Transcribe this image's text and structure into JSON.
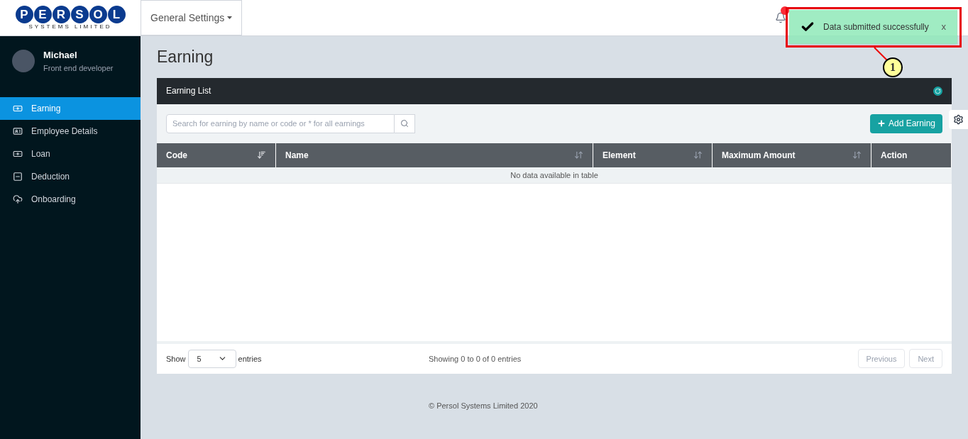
{
  "logo": {
    "letters": [
      "P",
      "E",
      "R",
      "S",
      "O",
      "L"
    ],
    "tagline": "SYSTEMS LIMITED"
  },
  "header": {
    "menu": "General Settings",
    "notification_badge": true
  },
  "toast": {
    "message": "Data submitted successfully",
    "close": "x"
  },
  "annotation": {
    "label": "1"
  },
  "profile": {
    "name": "Michael",
    "role": "Front end developer"
  },
  "nav": [
    {
      "label": "Earning",
      "selected": true
    },
    {
      "label": "Employee Details",
      "selected": false
    },
    {
      "label": "Loan",
      "selected": false
    },
    {
      "label": "Deduction",
      "selected": false
    },
    {
      "label": "Onboarding",
      "selected": false
    }
  ],
  "page_title": "Earning",
  "panel": {
    "title": "Earning List",
    "search": {
      "placeholder": "Search for earning by name or code or * for all earnings"
    },
    "add_button": "Add Earning",
    "table": {
      "columns": [
        {
          "label": "Code",
          "kind": "sorted"
        },
        {
          "label": "Name",
          "kind": "sortable"
        },
        {
          "label": "Element",
          "kind": "sortable"
        },
        {
          "label": "Maximum Amount",
          "kind": "sortable"
        },
        {
          "label": "Action",
          "kind": "plain"
        }
      ],
      "empty": "No data available in table"
    },
    "length": {
      "before": "Show",
      "value": "5",
      "after": "entries"
    },
    "info": "Showing 0 to 0 of 0 entries",
    "pager": [
      {
        "label": "Previous",
        "disabled": true
      },
      {
        "label": "Next",
        "disabled": true
      }
    ]
  },
  "footer": "© Persol Systems Limited 2020"
}
